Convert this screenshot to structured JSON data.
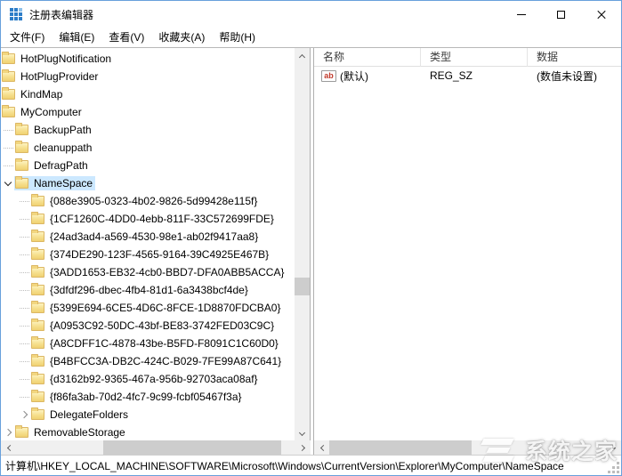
{
  "window": {
    "title": "注册表编辑器"
  },
  "menubar": {
    "items": [
      "文件(F)",
      "编辑(E)",
      "查看(V)",
      "收藏夹(A)",
      "帮助(H)"
    ]
  },
  "tree": {
    "items": [
      {
        "label": "HotPlugNotification",
        "level": 1,
        "expander": null,
        "connector": false,
        "selected": false
      },
      {
        "label": "HotPlugProvider",
        "level": 1,
        "expander": null,
        "connector": false,
        "selected": false
      },
      {
        "label": "KindMap",
        "level": 1,
        "expander": null,
        "connector": false,
        "selected": false
      },
      {
        "label": "MyComputer",
        "level": 1,
        "expander": null,
        "connector": false,
        "selected": false
      },
      {
        "label": "BackupPath",
        "level": 2,
        "expander": null,
        "connector": true,
        "selected": false
      },
      {
        "label": "cleanuppath",
        "level": 2,
        "expander": null,
        "connector": true,
        "selected": false
      },
      {
        "label": "DefragPath",
        "level": 2,
        "expander": null,
        "connector": true,
        "selected": false
      },
      {
        "label": "NameSpace",
        "level": 2,
        "expander": "open",
        "connector": false,
        "selected": true
      },
      {
        "label": "{088e3905-0323-4b02-9826-5d99428e115f}",
        "level": 3,
        "expander": null,
        "connector": true,
        "selected": false
      },
      {
        "label": "{1CF1260C-4DD0-4ebb-811F-33C572699FDE}",
        "level": 3,
        "expander": null,
        "connector": true,
        "selected": false
      },
      {
        "label": "{24ad3ad4-a569-4530-98e1-ab02f9417aa8}",
        "level": 3,
        "expander": null,
        "connector": true,
        "selected": false
      },
      {
        "label": "{374DE290-123F-4565-9164-39C4925E467B}",
        "level": 3,
        "expander": null,
        "connector": true,
        "selected": false
      },
      {
        "label": "{3ADD1653-EB32-4cb0-BBD7-DFA0ABB5ACCA}",
        "level": 3,
        "expander": null,
        "connector": true,
        "selected": false
      },
      {
        "label": "{3dfdf296-dbec-4fb4-81d1-6a3438bcf4de}",
        "level": 3,
        "expander": null,
        "connector": true,
        "selected": false
      },
      {
        "label": "{5399E694-6CE5-4D6C-8FCE-1D8870FDCBA0}",
        "level": 3,
        "expander": null,
        "connector": true,
        "selected": false
      },
      {
        "label": "{A0953C92-50DC-43bf-BE83-3742FED03C9C}",
        "level": 3,
        "expander": null,
        "connector": true,
        "selected": false
      },
      {
        "label": "{A8CDFF1C-4878-43be-B5FD-F8091C1C60D0}",
        "level": 3,
        "expander": null,
        "connector": true,
        "selected": false
      },
      {
        "label": "{B4BFCC3A-DB2C-424C-B029-7FE99A87C641}",
        "level": 3,
        "expander": null,
        "connector": true,
        "selected": false
      },
      {
        "label": "{d3162b92-9365-467a-956b-92703aca08af}",
        "level": 3,
        "expander": null,
        "connector": true,
        "selected": false
      },
      {
        "label": "{f86fa3ab-70d2-4fc7-9c99-fcbf05467f3a}",
        "level": 3,
        "expander": null,
        "connector": true,
        "selected": false
      },
      {
        "label": "DelegateFolders",
        "level": 3,
        "expander": "closed",
        "connector": false,
        "selected": false
      },
      {
        "label": "RemovableStorage",
        "level": 2,
        "expander": "closed",
        "connector": false,
        "selected": false
      }
    ]
  },
  "list": {
    "columns": [
      "名称",
      "类型",
      "数据"
    ],
    "rows": [
      {
        "icon": "ab",
        "name": "(默认)",
        "type": "REG_SZ",
        "data": "(数值未设置)"
      }
    ]
  },
  "statusbar": {
    "path": "计算机\\HKEY_LOCAL_MACHINE\\SOFTWARE\\Microsoft\\Windows\\CurrentVersion\\Explorer\\MyComputer\\NameSpace"
  },
  "watermark": {
    "text": "系统之家"
  },
  "colors": {
    "window_border": "#68a0dc",
    "selection": "#cce8ff",
    "folder": "#f6df8d",
    "scroll_thumb": "#cdcdcd"
  }
}
